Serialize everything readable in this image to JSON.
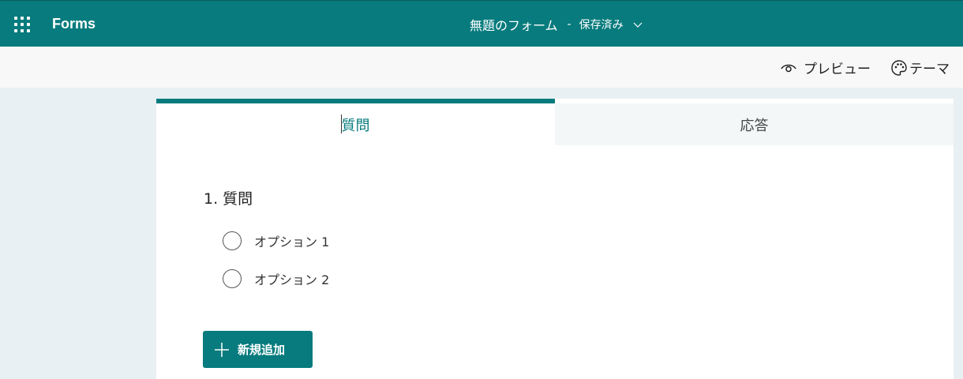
{
  "topbar": {
    "app_name": "Forms",
    "form_title": "無題のフォーム",
    "separator": "-",
    "save_status": "保存済み",
    "background_color": "#077b7d"
  },
  "commandbar": {
    "preview_label": "プレビュー",
    "theme_label": "テーマ",
    "preview_icon": "eye-icon",
    "theme_icon": "palette-icon"
  },
  "tabs": [
    {
      "label": "質問",
      "selected": true
    },
    {
      "label": "応答",
      "selected": false
    }
  ],
  "question": {
    "title": "1. 質問",
    "options": [
      "オプション 1",
      "オプション 2"
    ]
  },
  "add_button": {
    "label": "新規追加",
    "icon": "plus-icon"
  },
  "colors": {
    "accent": "#077b7d",
    "page_background": "#e9f0f3"
  }
}
